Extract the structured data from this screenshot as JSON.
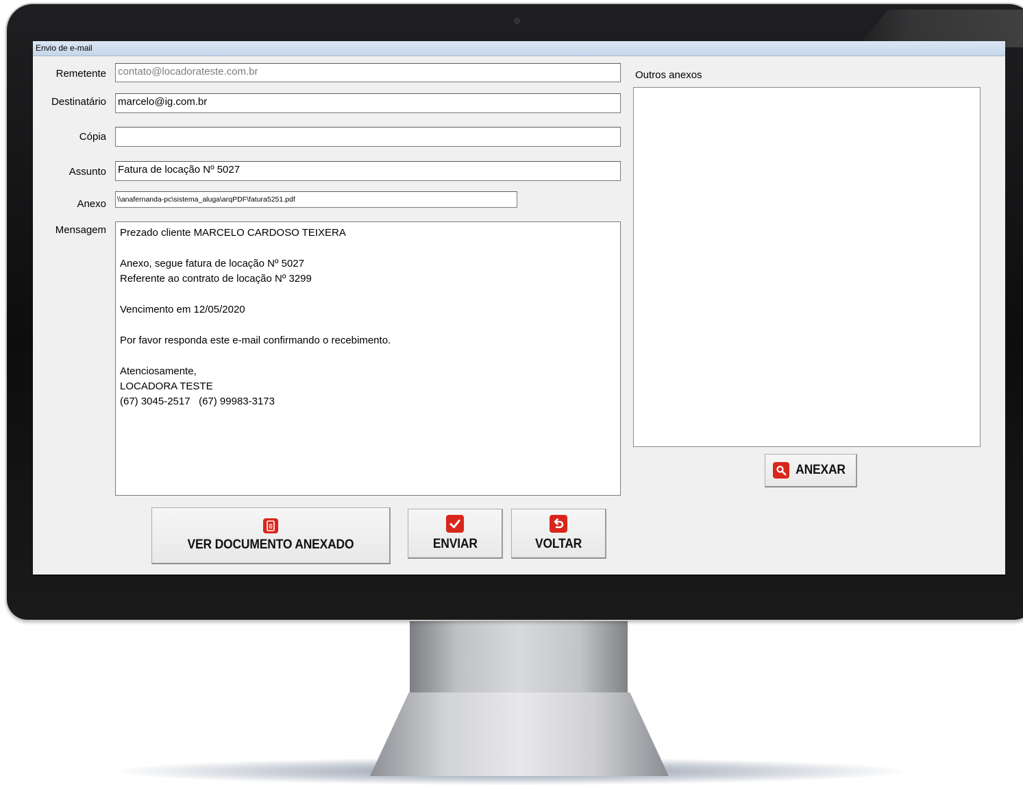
{
  "window": {
    "title": "Envio de e-mail"
  },
  "form": {
    "remetente": {
      "label": "Remetente",
      "value": "contato@locadorateste.com.br"
    },
    "destinatario": {
      "label": "Destinatário",
      "value": "marcelo@ig.com.br"
    },
    "copia": {
      "label": "Cópia",
      "value": ""
    },
    "assunto": {
      "label": "Assunto",
      "value": "Fatura de locação Nº 5027"
    },
    "anexo": {
      "label": "Anexo",
      "value": "\\\\anafernanda-pc\\sistema_aluga\\arqPDF\\fatura5251.pdf"
    },
    "mensagem": {
      "label": "Mensagem",
      "lines": [
        "Prezado cliente MARCELO CARDOSO TEIXERA",
        "",
        "Anexo, segue fatura de locação Nº 5027",
        "Referente ao contrato de locação Nº 3299",
        "",
        "Vencimento em 12/05/2020",
        "",
        "Por favor responda este e-mail confirmando o recebimento.",
        "",
        "Atenciosamente,",
        "LOCADORA TESTE",
        "(67) 3045-2517   (67) 99983-3173"
      ]
    }
  },
  "outros_anexos": {
    "label": "Outros anexos",
    "items": []
  },
  "buttons": {
    "anexar": {
      "label": "ANEXAR",
      "icon": "search-icon"
    },
    "ver_documento": {
      "label": "VER DOCUMENTO ANEXADO",
      "icon": "document-icon"
    },
    "enviar": {
      "label": "ENVIAR",
      "icon": "checkmark-icon"
    },
    "voltar": {
      "label": "VOLTAR",
      "icon": "undo-icon"
    }
  },
  "colors": {
    "icon_red": "#d9261c",
    "titlebar": "#c6d6ea",
    "window_bg": "#f0f0f0"
  }
}
